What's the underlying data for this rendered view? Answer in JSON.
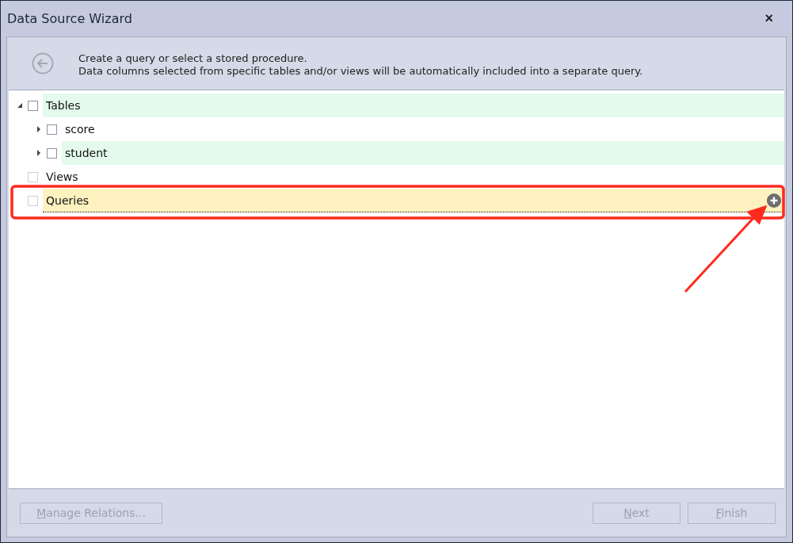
{
  "window": {
    "title": "Data Source Wizard",
    "close": "×"
  },
  "header": {
    "lines": [
      "Create a query or select a stored procedure.",
      "Data columns selected from specific tables and/or views will be automatically included into a separate query."
    ]
  },
  "tree": [
    {
      "label": "Tables",
      "expanded": true,
      "checked": false,
      "disabled": false,
      "highlighted": true,
      "selected": false,
      "children": [
        {
          "label": "score",
          "expandable": true,
          "expanded": false,
          "checked": false,
          "disabled": false,
          "highlighted": false,
          "selected": false
        },
        {
          "label": "student",
          "expandable": true,
          "expanded": false,
          "checked": false,
          "disabled": false,
          "highlighted": true,
          "selected": false
        }
      ]
    },
    {
      "label": "Views",
      "checked": false,
      "disabled": true,
      "highlighted": false,
      "selected": false
    },
    {
      "label": "Queries",
      "checked": false,
      "disabled": true,
      "highlighted": false,
      "selected": true,
      "add_button": true
    }
  ],
  "buttons": [
    {
      "label": "Manage Relations...",
      "disabled": true,
      "kind": "left"
    },
    {
      "label": "Next",
      "disabled": true,
      "kind": "right"
    },
    {
      "label": "Finish",
      "disabled": true,
      "kind": "right"
    }
  ]
}
